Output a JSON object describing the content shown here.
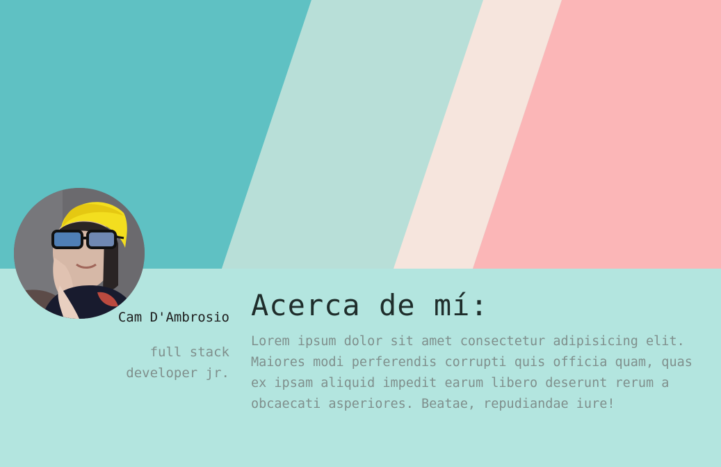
{
  "hero": {
    "colors": {
      "teal": "#5fc1c3",
      "mint": "#b8dfd8",
      "cream": "#f6e5dd",
      "pink": "#fbb6b7"
    }
  },
  "profile": {
    "name": "Cam D'Ambrosio",
    "role": "full stack developer jr."
  },
  "about": {
    "title": "Acerca de mí:",
    "text": "Lorem ipsum dolor sit amet consectetur adipisicing elit. Maiores modi perferendis corrupti quis officia quam, quas ex ipsam aliquid impedit earum libero deserunt rerum a obcaecati asperiores. Beatae, repudiandae iure!"
  },
  "colors": {
    "section_background": "#b3e5df",
    "name_text": "#1d1d1d",
    "muted_text": "#7f8f8c"
  }
}
